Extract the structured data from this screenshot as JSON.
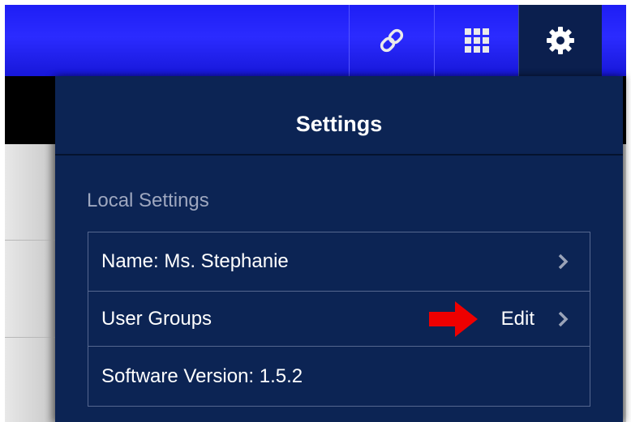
{
  "toolbar": {
    "buttons": [
      {
        "icon": "link-icon"
      },
      {
        "icon": "grid-icon"
      },
      {
        "icon": "gear-icon",
        "active": true
      }
    ]
  },
  "settings": {
    "title": "Settings",
    "section_label": "Local Settings",
    "rows": [
      {
        "label": "Name: Ms. Stephanie",
        "has_chevron": true
      },
      {
        "label": "User Groups",
        "action": "Edit",
        "has_chevron": true
      },
      {
        "label": "Software Version: 1.5.2",
        "has_chevron": false
      }
    ]
  },
  "colors": {
    "toolbar_blue": "#2b2bff",
    "panel_navy": "#0c2454",
    "annotation_arrow": "#ee0000"
  }
}
